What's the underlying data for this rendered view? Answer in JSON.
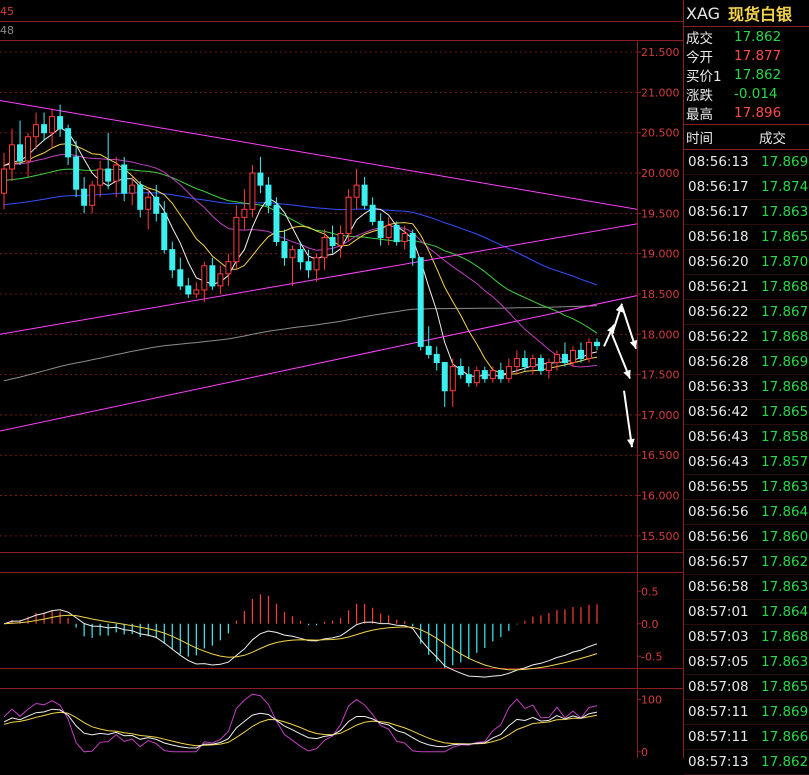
{
  "colors": {
    "up": "#ff3b3b",
    "down": "#3cf0f0",
    "grid": "#8a1f1f",
    "axis_text": "#d23c3c",
    "ma5": "#f0f0f0",
    "ma10": "#f2d34a",
    "ma20": "#c040c0",
    "ma30": "#40d040",
    "ma60": "#3050ff",
    "ma120": "#8c8c8c",
    "trendline": "#ff40ff",
    "arrow": "#ffffff"
  },
  "header_fragments": {
    "line1": "45",
    "line2": "48"
  },
  "instrument": {
    "code": "XAG",
    "name": "现货白银"
  },
  "quotes": [
    {
      "label": "成交",
      "value": "17.862",
      "color": "green"
    },
    {
      "label": "今开",
      "value": "17.877",
      "color": "red"
    },
    {
      "label": "买价1",
      "value": "17.862",
      "color": "green"
    },
    {
      "label": "涨跌",
      "value": "-0.014",
      "color": "green"
    },
    {
      "label": "最高",
      "value": "17.896",
      "color": "red"
    }
  ],
  "ticks_header": {
    "time": "时间",
    "price": "成交"
  },
  "ticks": [
    {
      "time": "08:56:13",
      "price": "17.869"
    },
    {
      "time": "08:56:17",
      "price": "17.874"
    },
    {
      "time": "08:56:17",
      "price": "17.863"
    },
    {
      "time": "08:56:18",
      "price": "17.865"
    },
    {
      "time": "08:56:20",
      "price": "17.870"
    },
    {
      "time": "08:56:21",
      "price": "17.868"
    },
    {
      "time": "08:56:22",
      "price": "17.867"
    },
    {
      "time": "08:56:22",
      "price": "17.868"
    },
    {
      "time": "08:56:28",
      "price": "17.869"
    },
    {
      "time": "08:56:33",
      "price": "17.868"
    },
    {
      "time": "08:56:42",
      "price": "17.865"
    },
    {
      "time": "08:56:43",
      "price": "17.858"
    },
    {
      "time": "08:56:43",
      "price": "17.857"
    },
    {
      "time": "08:56:55",
      "price": "17.863"
    },
    {
      "time": "08:56:56",
      "price": "17.864"
    },
    {
      "time": "08:56:56",
      "price": "17.860"
    },
    {
      "time": "08:56:57",
      "price": "17.862"
    },
    {
      "time": "08:56:58",
      "price": "17.863"
    },
    {
      "time": "08:57:01",
      "price": "17.864"
    },
    {
      "time": "08:57:03",
      "price": "17.868"
    },
    {
      "time": "08:57:05",
      "price": "17.863"
    },
    {
      "time": "08:57:08",
      "price": "17.865"
    },
    {
      "time": "08:57:11",
      "price": "17.869"
    },
    {
      "time": "08:57:11",
      "price": "17.866"
    },
    {
      "time": "08:57:13",
      "price": "17.862"
    }
  ],
  "chart_data": [
    {
      "type": "candlestick",
      "ylim": [
        15.3,
        21.65
      ],
      "yticks": [
        "21.500",
        "21.000",
        "20.500",
        "20.000",
        "19.500",
        "19.000",
        "18.500",
        "18.000",
        "17.500",
        "17.000",
        "16.500",
        "16.000",
        "15.500"
      ],
      "candles": [
        {
          "o": 19.75,
          "h": 20.25,
          "l": 19.55,
          "c": 20.05
        },
        {
          "o": 20.05,
          "h": 20.55,
          "l": 19.9,
          "c": 20.35
        },
        {
          "o": 20.35,
          "h": 20.65,
          "l": 20.1,
          "c": 20.15
        },
        {
          "o": 20.15,
          "h": 20.5,
          "l": 19.95,
          "c": 20.45
        },
        {
          "o": 20.45,
          "h": 20.75,
          "l": 20.3,
          "c": 20.6
        },
        {
          "o": 20.6,
          "h": 20.75,
          "l": 20.4,
          "c": 20.5
        },
        {
          "o": 20.5,
          "h": 20.8,
          "l": 20.3,
          "c": 20.7
        },
        {
          "o": 20.7,
          "h": 20.85,
          "l": 20.45,
          "c": 20.55
        },
        {
          "o": 20.55,
          "h": 20.6,
          "l": 20.1,
          "c": 20.2
        },
        {
          "o": 20.2,
          "h": 20.4,
          "l": 19.7,
          "c": 19.8
        },
        {
          "o": 19.8,
          "h": 19.95,
          "l": 19.5,
          "c": 19.6
        },
        {
          "o": 19.6,
          "h": 19.9,
          "l": 19.5,
          "c": 19.85
        },
        {
          "o": 19.85,
          "h": 20.15,
          "l": 19.7,
          "c": 20.05
        },
        {
          "o": 20.05,
          "h": 20.5,
          "l": 19.8,
          "c": 19.9
        },
        {
          "o": 19.9,
          "h": 20.2,
          "l": 19.7,
          "c": 20.1
        },
        {
          "o": 20.1,
          "h": 20.2,
          "l": 19.65,
          "c": 19.75
        },
        {
          "o": 19.75,
          "h": 19.95,
          "l": 19.6,
          "c": 19.85
        },
        {
          "o": 19.85,
          "h": 19.9,
          "l": 19.45,
          "c": 19.55
        },
        {
          "o": 19.55,
          "h": 19.8,
          "l": 19.3,
          "c": 19.7
        },
        {
          "o": 19.7,
          "h": 19.85,
          "l": 19.4,
          "c": 19.5
        },
        {
          "o": 19.5,
          "h": 19.65,
          "l": 19.0,
          "c": 19.05
        },
        {
          "o": 19.05,
          "h": 19.15,
          "l": 18.7,
          "c": 18.8
        },
        {
          "o": 18.8,
          "h": 18.95,
          "l": 18.55,
          "c": 18.6
        },
        {
          "o": 18.6,
          "h": 18.7,
          "l": 18.45,
          "c": 18.5
        },
        {
          "o": 18.5,
          "h": 18.65,
          "l": 18.45,
          "c": 18.55
        },
        {
          "o": 18.55,
          "h": 18.9,
          "l": 18.4,
          "c": 18.85
        },
        {
          "o": 18.85,
          "h": 18.95,
          "l": 18.55,
          "c": 18.6
        },
        {
          "o": 18.6,
          "h": 18.85,
          "l": 18.5,
          "c": 18.75
        },
        {
          "o": 18.75,
          "h": 19.0,
          "l": 18.6,
          "c": 18.9
        },
        {
          "o": 18.9,
          "h": 19.6,
          "l": 18.8,
          "c": 19.45
        },
        {
          "o": 19.45,
          "h": 19.8,
          "l": 19.3,
          "c": 19.55
        },
        {
          "o": 19.55,
          "h": 20.1,
          "l": 19.45,
          "c": 20.0
        },
        {
          "o": 20.0,
          "h": 20.2,
          "l": 19.75,
          "c": 19.85
        },
        {
          "o": 19.85,
          "h": 19.95,
          "l": 19.5,
          "c": 19.6
        },
        {
          "o": 19.6,
          "h": 19.7,
          "l": 19.1,
          "c": 19.15
        },
        {
          "o": 19.15,
          "h": 19.3,
          "l": 18.85,
          "c": 18.95
        },
        {
          "o": 18.95,
          "h": 19.1,
          "l": 18.6,
          "c": 19.05
        },
        {
          "o": 19.05,
          "h": 19.15,
          "l": 18.8,
          "c": 18.9
        },
        {
          "o": 18.9,
          "h": 19.05,
          "l": 18.7,
          "c": 18.8
        },
        {
          "o": 18.8,
          "h": 19.0,
          "l": 18.65,
          "c": 18.95
        },
        {
          "o": 18.95,
          "h": 19.3,
          "l": 18.8,
          "c": 19.2
        },
        {
          "o": 19.2,
          "h": 19.35,
          "l": 19.0,
          "c": 19.1
        },
        {
          "o": 19.1,
          "h": 19.35,
          "l": 18.95,
          "c": 19.25
        },
        {
          "o": 19.25,
          "h": 19.8,
          "l": 19.15,
          "c": 19.7
        },
        {
          "o": 19.7,
          "h": 20.05,
          "l": 19.55,
          "c": 19.85
        },
        {
          "o": 19.85,
          "h": 19.95,
          "l": 19.55,
          "c": 19.6
        },
        {
          "o": 19.6,
          "h": 19.7,
          "l": 19.35,
          "c": 19.4
        },
        {
          "o": 19.4,
          "h": 19.5,
          "l": 19.1,
          "c": 19.2
        },
        {
          "o": 19.2,
          "h": 19.45,
          "l": 19.1,
          "c": 19.35
        },
        {
          "o": 19.35,
          "h": 19.4,
          "l": 19.1,
          "c": 19.15
        },
        {
          "o": 19.15,
          "h": 19.35,
          "l": 19.05,
          "c": 19.25
        },
        {
          "o": 19.25,
          "h": 19.3,
          "l": 18.85,
          "c": 18.95
        },
        {
          "o": 18.95,
          "h": 18.95,
          "l": 17.8,
          "c": 17.85
        },
        {
          "o": 17.85,
          "h": 18.1,
          "l": 17.7,
          "c": 17.75
        },
        {
          "o": 17.75,
          "h": 17.85,
          "l": 17.55,
          "c": 17.65
        },
        {
          "o": 17.65,
          "h": 17.65,
          "l": 17.1,
          "c": 17.3
        },
        {
          "o": 17.3,
          "h": 17.7,
          "l": 17.1,
          "c": 17.6
        },
        {
          "o": 17.6,
          "h": 17.7,
          "l": 17.45,
          "c": 17.5
        },
        {
          "o": 17.5,
          "h": 17.6,
          "l": 17.35,
          "c": 17.4
        },
        {
          "o": 17.4,
          "h": 17.6,
          "l": 17.35,
          "c": 17.55
        },
        {
          "o": 17.55,
          "h": 17.6,
          "l": 17.4,
          "c": 17.45
        },
        {
          "o": 17.45,
          "h": 17.6,
          "l": 17.4,
          "c": 17.55
        },
        {
          "o": 17.55,
          "h": 17.65,
          "l": 17.4,
          "c": 17.45
        },
        {
          "o": 17.45,
          "h": 17.7,
          "l": 17.4,
          "c": 17.6
        },
        {
          "o": 17.6,
          "h": 17.8,
          "l": 17.5,
          "c": 17.7
        },
        {
          "o": 17.7,
          "h": 17.8,
          "l": 17.55,
          "c": 17.6
        },
        {
          "o": 17.6,
          "h": 17.75,
          "l": 17.5,
          "c": 17.7
        },
        {
          "o": 17.7,
          "h": 17.75,
          "l": 17.5,
          "c": 17.55
        },
        {
          "o": 17.55,
          "h": 17.7,
          "l": 17.45,
          "c": 17.65
        },
        {
          "o": 17.65,
          "h": 17.8,
          "l": 17.55,
          "c": 17.75
        },
        {
          "o": 17.75,
          "h": 17.9,
          "l": 17.6,
          "c": 17.65
        },
        {
          "o": 17.65,
          "h": 17.85,
          "l": 17.6,
          "c": 17.8
        },
        {
          "o": 17.8,
          "h": 17.9,
          "l": 17.65,
          "c": 17.7
        },
        {
          "o": 17.7,
          "h": 17.95,
          "l": 17.65,
          "c": 17.9
        },
        {
          "o": 17.9,
          "h": 17.95,
          "l": 17.8,
          "c": 17.86
        }
      ]
    },
    {
      "type": "macd",
      "yticks": [
        "0.5",
        "0.0",
        "-0.5"
      ],
      "ylim": [
        -0.65,
        0.75
      ]
    },
    {
      "type": "oscillator",
      "yticks": [
        "100",
        "0"
      ],
      "ylim": [
        -8,
        118
      ]
    }
  ]
}
